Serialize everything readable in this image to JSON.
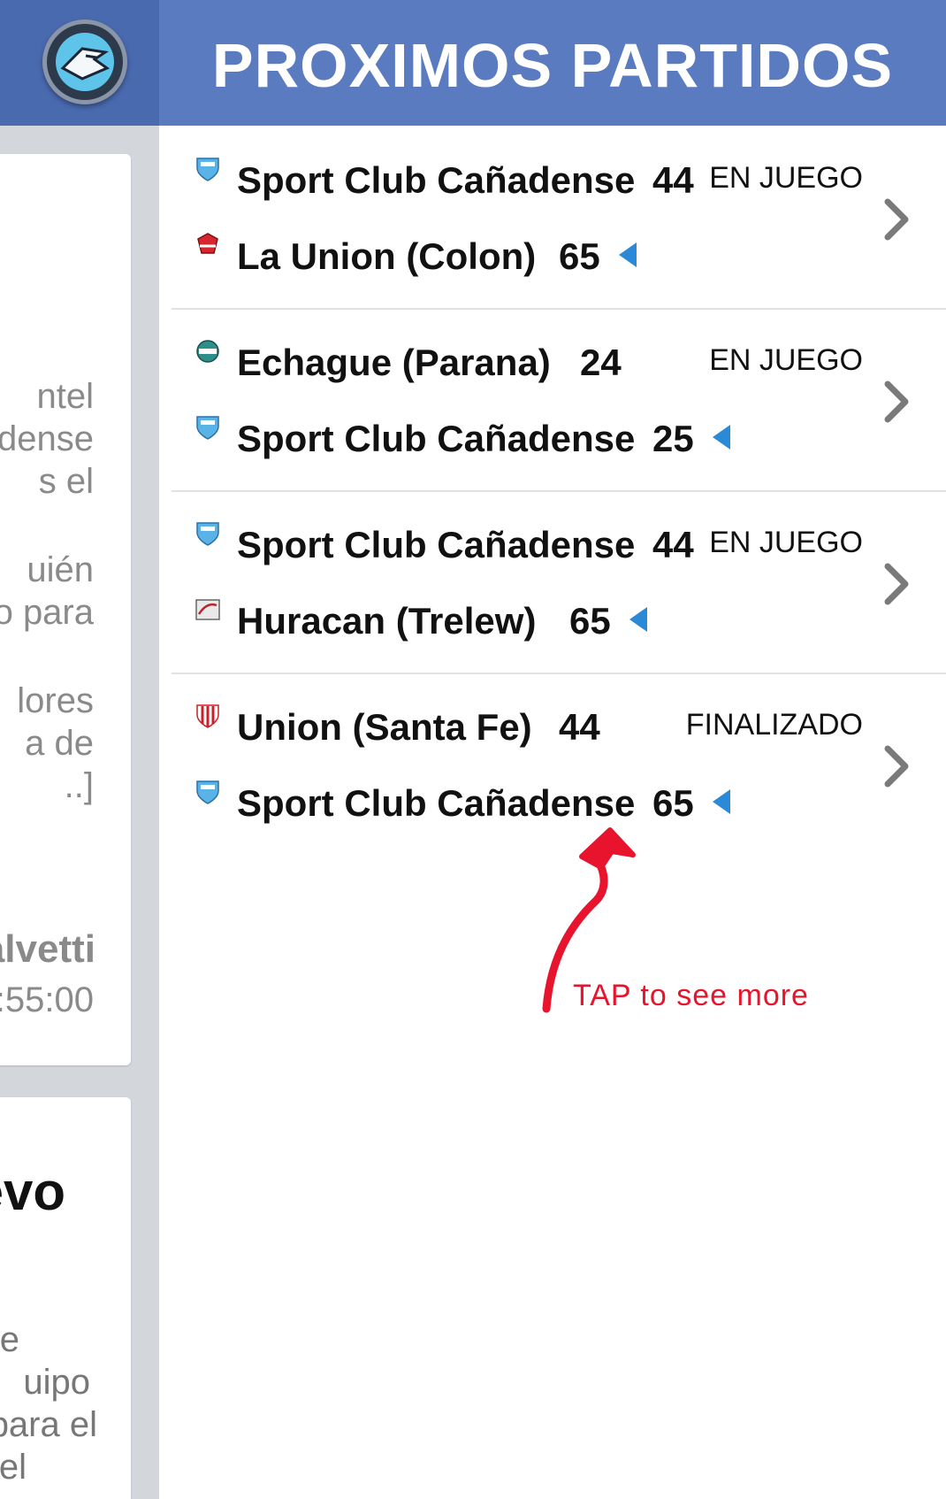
{
  "header": {
    "title": "PROXIMOS PARTIDOS"
  },
  "background_page": {
    "card1_fragments": [
      "ntel",
      "dense",
      "s el",
      "uién",
      "o para",
      "lores",
      "a de",
      "..]",
      "alvetti",
      ":55:00"
    ],
    "card2_fragments": [
      "evo",
      "e",
      "uipo",
      "para el",
      "el"
    ]
  },
  "matches": [
    {
      "home": {
        "name": "Sport Club Cañadense",
        "score": "44",
        "crest": "scc-shield-icon"
      },
      "away": {
        "name": "La Union (Colon)",
        "score": "65",
        "crest": "la-union-crest-icon"
      },
      "winner": "away",
      "status": "EN JUEGO"
    },
    {
      "home": {
        "name": "Echague (Parana)",
        "score": "24",
        "crest": "echague-crest-icon"
      },
      "away": {
        "name": "Sport Club Cañadense",
        "score": "25",
        "crest": "scc-shield-icon"
      },
      "winner": "away",
      "status": "EN JUEGO"
    },
    {
      "home": {
        "name": "Sport Club Cañadense",
        "score": "44",
        "crest": "scc-shield-icon"
      },
      "away": {
        "name": "Huracan (Trelew)",
        "score": "65",
        "crest": "huracan-crest-icon"
      },
      "winner": "away",
      "status": "EN JUEGO"
    },
    {
      "home": {
        "name": "Union (Santa Fe)",
        "score": "44",
        "crest": "union-santa-fe-crest-icon"
      },
      "away": {
        "name": "Sport Club Cañadense",
        "score": "65",
        "crest": "scc-shield-icon"
      },
      "winner": "away",
      "status": "FINALIZADO"
    }
  ],
  "annotation": {
    "text": "TAP to see more",
    "color": "#e8142d"
  },
  "colors": {
    "header_bg": "#5a7bbf",
    "left_header_bg": "#4a6ab0",
    "winner_arrow": "#2a8ad8"
  }
}
